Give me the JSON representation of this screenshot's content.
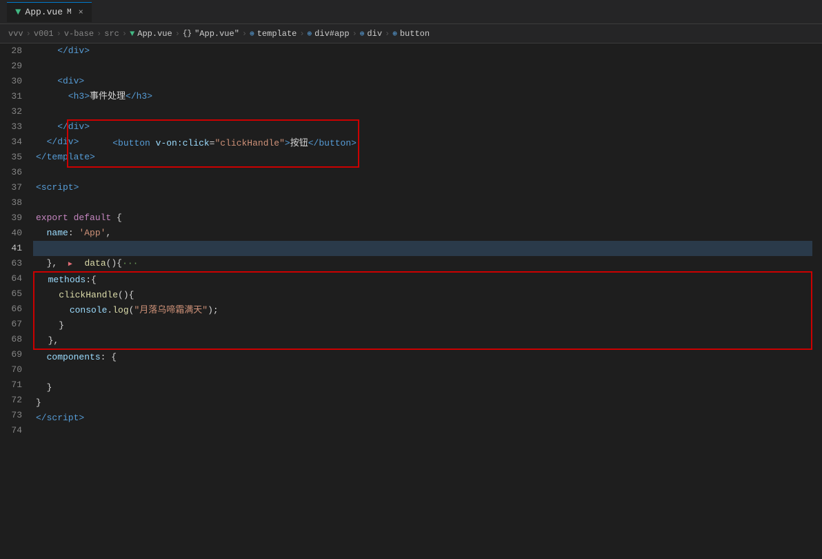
{
  "titleBar": {
    "tabIcon": "▼",
    "tabName": "App.vue",
    "tabModified": "M",
    "tabClose": "×"
  },
  "breadcrumb": {
    "items": [
      {
        "text": "vvv",
        "type": "plain"
      },
      {
        "text": ">",
        "type": "sep"
      },
      {
        "text": "v001",
        "type": "plain"
      },
      {
        "text": ">",
        "type": "sep"
      },
      {
        "text": "v-base",
        "type": "plain"
      },
      {
        "text": ">",
        "type": "sep"
      },
      {
        "text": "src",
        "type": "plain"
      },
      {
        "text": ">",
        "type": "sep"
      },
      {
        "text": "App.vue",
        "type": "vue"
      },
      {
        "text": ">",
        "type": "sep"
      },
      {
        "text": "{}",
        "type": "obj"
      },
      {
        "text": "\"App.vue\"",
        "type": "plain"
      },
      {
        "text": ">",
        "type": "sep"
      },
      {
        "text": "⊕",
        "type": "tag"
      },
      {
        "text": "template",
        "type": "plain"
      },
      {
        "text": ">",
        "type": "sep"
      },
      {
        "text": "⊕",
        "type": "tag"
      },
      {
        "text": "div#app",
        "type": "plain"
      },
      {
        "text": ">",
        "type": "sep"
      },
      {
        "text": "⊕",
        "type": "tag"
      },
      {
        "text": "div",
        "type": "plain"
      },
      {
        "text": ">",
        "type": "sep"
      },
      {
        "text": "⊕",
        "type": "tag"
      },
      {
        "text": "button",
        "type": "plain"
      }
    ]
  },
  "lines": [
    {
      "num": 28,
      "content": [
        {
          "t": "    </",
          "c": "c-tag"
        },
        {
          "t": "div",
          "c": "c-tag"
        },
        {
          "t": ">",
          "c": "c-tag"
        }
      ]
    },
    {
      "num": 29,
      "content": []
    },
    {
      "num": 30,
      "content": [
        {
          "t": "    <",
          "c": "c-tag"
        },
        {
          "t": "div",
          "c": "c-tag"
        },
        {
          "t": ">",
          "c": "c-tag"
        }
      ]
    },
    {
      "num": 31,
      "content": [
        {
          "t": "      <",
          "c": "c-tag"
        },
        {
          "t": "h3",
          "c": "c-tag"
        },
        {
          "t": ">",
          "c": "c-tag"
        },
        {
          "t": "事件处理",
          "c": "c-chinese"
        },
        {
          "t": "</",
          "c": "c-tag"
        },
        {
          "t": "h3",
          "c": "c-tag"
        },
        {
          "t": ">",
          "c": "c-tag"
        }
      ]
    },
    {
      "num": 32,
      "content": [
        {
          "t": "      <",
          "c": "c-tag"
        },
        {
          "t": "button",
          "c": "c-tag"
        },
        {
          "t": " ",
          "c": "c-text"
        },
        {
          "t": "v-on:click",
          "c": "c-vuedir"
        },
        {
          "t": "=",
          "c": "c-punct"
        },
        {
          "t": "\"clickHandle\"",
          "c": "c-string"
        },
        {
          "t": ">",
          "c": "c-tag"
        },
        {
          "t": "按钮",
          "c": "c-chinese"
        },
        {
          "t": "</",
          "c": "c-tag"
        },
        {
          "t": "button",
          "c": "c-tag"
        },
        {
          "t": ">",
          "c": "c-tag"
        }
      ],
      "highlight32": true
    },
    {
      "num": 33,
      "content": [
        {
          "t": "    </",
          "c": "c-tag"
        },
        {
          "t": "div",
          "c": "c-tag"
        },
        {
          "t": ">",
          "c": "c-tag"
        }
      ]
    },
    {
      "num": 34,
      "content": [
        {
          "t": "  </",
          "c": "c-tag"
        },
        {
          "t": "div",
          "c": "c-tag"
        },
        {
          "t": ">",
          "c": "c-tag"
        }
      ]
    },
    {
      "num": 35,
      "content": [
        {
          "t": "</",
          "c": "c-tag"
        },
        {
          "t": "template",
          "c": "c-tag"
        },
        {
          "t": ">",
          "c": "c-tag"
        }
      ]
    },
    {
      "num": 36,
      "content": []
    },
    {
      "num": 37,
      "content": [
        {
          "t": "<",
          "c": "c-tag"
        },
        {
          "t": "script",
          "c": "c-tag"
        },
        {
          "t": ">",
          "c": "c-tag"
        }
      ]
    },
    {
      "num": 38,
      "content": []
    },
    {
      "num": 39,
      "content": [
        {
          "t": "export",
          "c": "c-keyword"
        },
        {
          "t": " ",
          "c": "c-text"
        },
        {
          "t": "default",
          "c": "c-keyword"
        },
        {
          "t": " {",
          "c": "c-punct"
        }
      ]
    },
    {
      "num": 40,
      "content": [
        {
          "t": "  ",
          "c": "c-text"
        },
        {
          "t": "name",
          "c": "c-prop"
        },
        {
          "t": ": ",
          "c": "c-punct"
        },
        {
          "t": "'App'",
          "c": "c-string"
        },
        {
          "t": ",",
          "c": "c-punct"
        }
      ]
    },
    {
      "num": 41,
      "content": [
        {
          "t": "  ",
          "c": "c-text"
        },
        {
          "t": "data",
          "c": "c-fn"
        },
        {
          "t": "(){",
          "c": "c-punct"
        },
        {
          "t": "···",
          "c": "c-comment"
        }
      ],
      "active": true,
      "folded": true
    },
    {
      "num": 63,
      "content": [
        {
          "t": "  },",
          "c": "c-punct"
        }
      ]
    },
    {
      "num": 64,
      "content": [
        {
          "t": "  ",
          "c": "c-text"
        },
        {
          "t": "methods",
          "c": "c-prop"
        },
        {
          "t": ":{",
          "c": "c-punct"
        }
      ],
      "methodsStart": true
    },
    {
      "num": 65,
      "content": [
        {
          "t": "    ",
          "c": "c-text"
        },
        {
          "t": "clickHandle",
          "c": "c-fn"
        },
        {
          "t": "(){",
          "c": "c-punct"
        }
      ]
    },
    {
      "num": 66,
      "content": [
        {
          "t": "      ",
          "c": "c-text"
        },
        {
          "t": "console",
          "c": "c-prop"
        },
        {
          "t": ".",
          "c": "c-punct"
        },
        {
          "t": "log",
          "c": "c-fn"
        },
        {
          "t": "(",
          "c": "c-punct"
        },
        {
          "t": "\"月落乌啼霜满天\"",
          "c": "c-string2"
        },
        {
          "t": ");",
          "c": "c-punct"
        }
      ]
    },
    {
      "num": 67,
      "content": [
        {
          "t": "    }",
          "c": "c-punct"
        }
      ]
    },
    {
      "num": 68,
      "content": [
        {
          "t": "  },",
          "c": "c-punct"
        }
      ],
      "methodsEnd": true
    },
    {
      "num": 69,
      "content": [
        {
          "t": "  ",
          "c": "c-text"
        },
        {
          "t": "components",
          "c": "c-prop"
        },
        {
          "t": ": {",
          "c": "c-punct"
        }
      ]
    },
    {
      "num": 70,
      "content": []
    },
    {
      "num": 71,
      "content": [
        {
          "t": "  }",
          "c": "c-punct"
        }
      ]
    },
    {
      "num": 72,
      "content": [
        {
          "t": "}",
          "c": "c-punct"
        }
      ]
    },
    {
      "num": 73,
      "content": [
        {
          "t": "</",
          "c": "c-tag"
        },
        {
          "t": "script",
          "c": "c-tag"
        },
        {
          "t": ">",
          "c": "c-tag"
        }
      ]
    },
    {
      "num": 74,
      "content": []
    }
  ]
}
